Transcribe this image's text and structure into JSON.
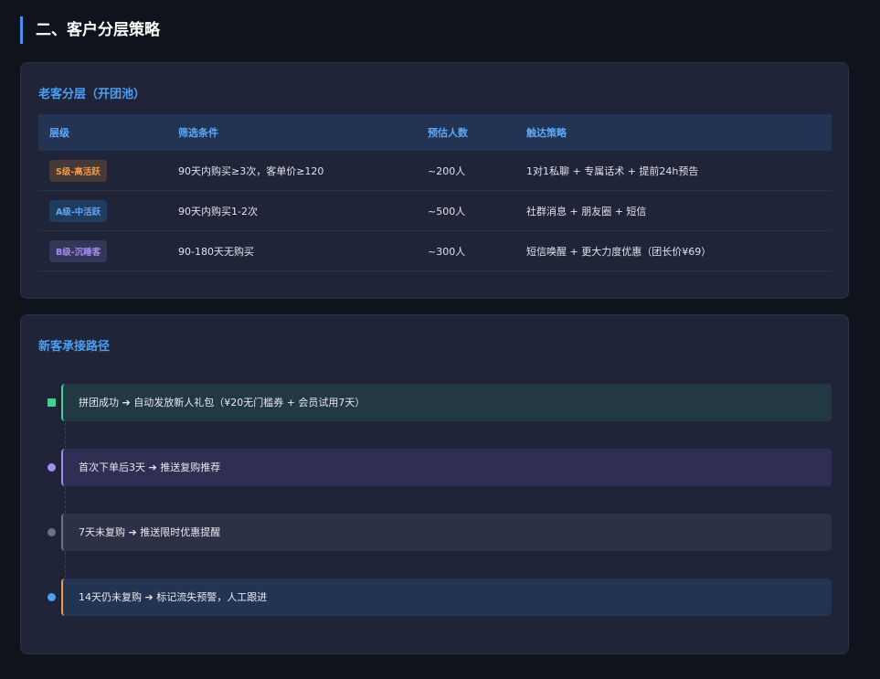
{
  "section_title": "二、客户分层策略",
  "old_customers": {
    "title": "老客分层（开团池）",
    "headers": [
      "层级",
      "筛选条件",
      "预估人数",
      "触达策略"
    ],
    "rows": [
      {
        "level": "S级-高活跃",
        "condition": "90天内购买≥3次，客单价≥120",
        "count": "~200人",
        "strategy": "1对1私聊 + 专属话术 + 提前24h预告"
      },
      {
        "level": "A级-中活跃",
        "condition": "90天内购买1-2次",
        "count": "~500人",
        "strategy": "社群消息 + 朋友圈 + 短信"
      },
      {
        "level": "B级-沉睡客",
        "condition": "90-180天无购买",
        "count": "~300人",
        "strategy": "短信唤醒 + 更大力度优惠（团长价¥69）"
      }
    ]
  },
  "new_customers": {
    "title": "新客承接路径",
    "steps": [
      {
        "text": "拼团成功 ➔ 自动发放新人礼包（¥20无门槛券 + 会员试用7天）",
        "color": "#3ed48e"
      },
      {
        "text": "首次下单后3天 ➔ 推送复购推荐",
        "color": "#a28cf5"
      },
      {
        "text": "7天未复购 ➔ 推送限时优惠提醒",
        "color": "#6c7385"
      },
      {
        "text": "14天仍未复购 ➔ 标记流失预警，人工跟进",
        "color": "#f2994a"
      }
    ]
  },
  "colors": {
    "accent": "#4b9ff5",
    "background": "#0f131b",
    "card": "#1f2438"
  }
}
